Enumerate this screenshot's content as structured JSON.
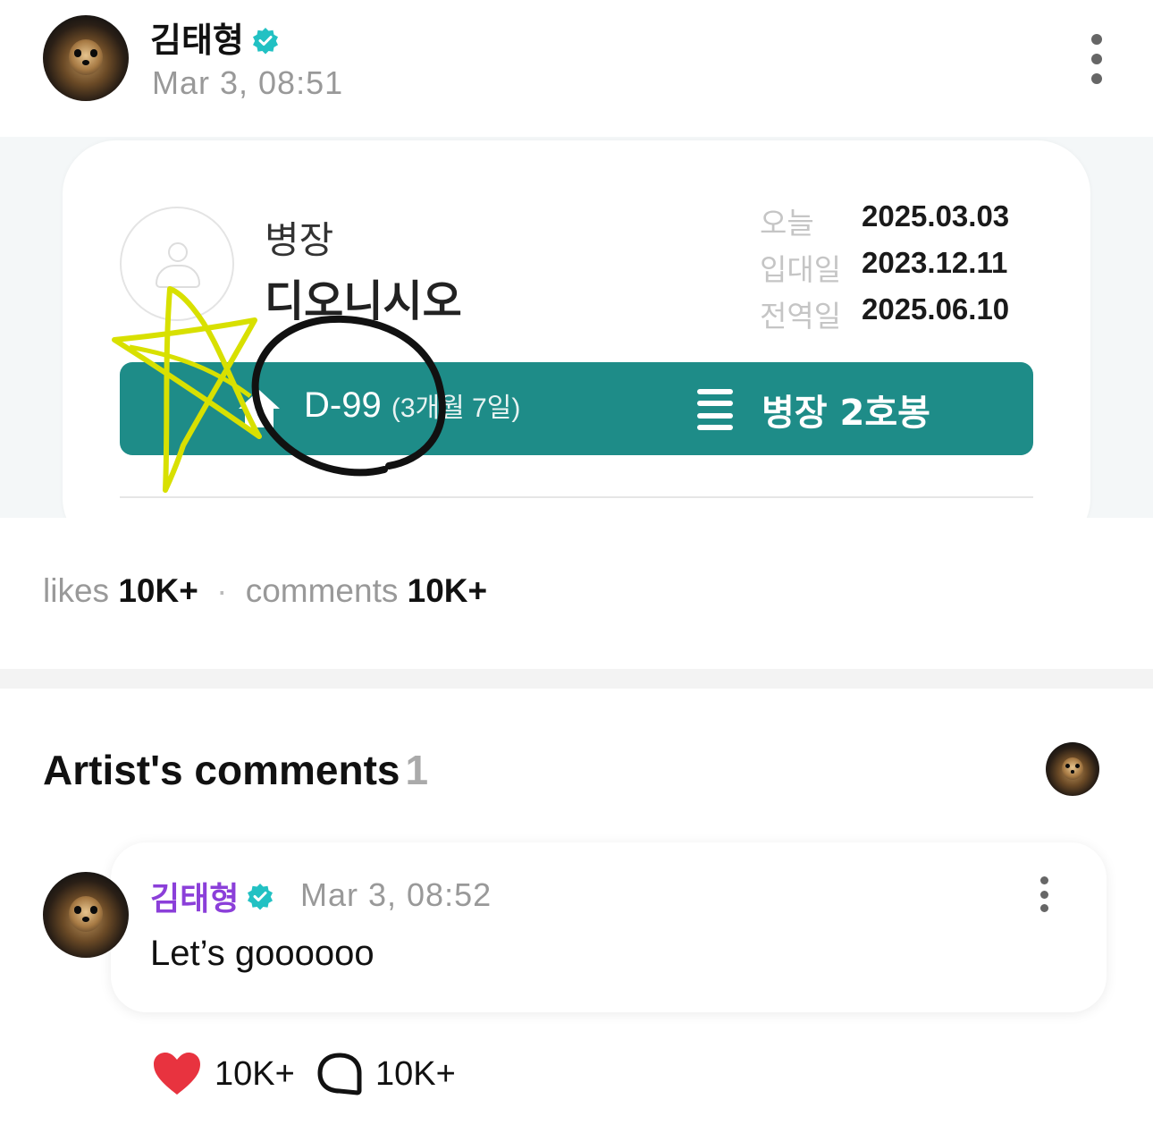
{
  "post": {
    "author": "김태형",
    "time": "Mar 3, 08:51",
    "likes_label": "likes",
    "likes_value": "10K+",
    "comments_label": "comments",
    "comments_value": "10K+",
    "separator": "·"
  },
  "military_card": {
    "rank": "병장",
    "unit": "디오니시오",
    "dates": [
      {
        "label": "오늘",
        "value": "2025.03.03"
      },
      {
        "label": "입대일",
        "value": "2023.12.11"
      },
      {
        "label": "전역일",
        "value": "2025.06.10"
      }
    ],
    "dday": "D-99",
    "dday_detail": "(3개월 7일)",
    "salary_grade": "병장 2호봉"
  },
  "artist_comments": {
    "title": "Artist's comments",
    "count": "1",
    "comment": {
      "author": "김태형",
      "time": "Mar 3, 08:52",
      "text": "Let’s goooooo",
      "like_count": "10K+",
      "reply_count": "10K+"
    }
  },
  "colors": {
    "accent_teal": "#1e8c88",
    "verified_badge": "#22c1c3",
    "comment_author": "#8b3fd9",
    "heart": "#e8333f",
    "scribble_yellow": "#d8e000"
  },
  "icons": [
    "verified-badge-icon",
    "more-options-icon",
    "home-icon",
    "menu-icon",
    "heart-icon",
    "comment-bubble-icon",
    "person-placeholder-icon"
  ]
}
